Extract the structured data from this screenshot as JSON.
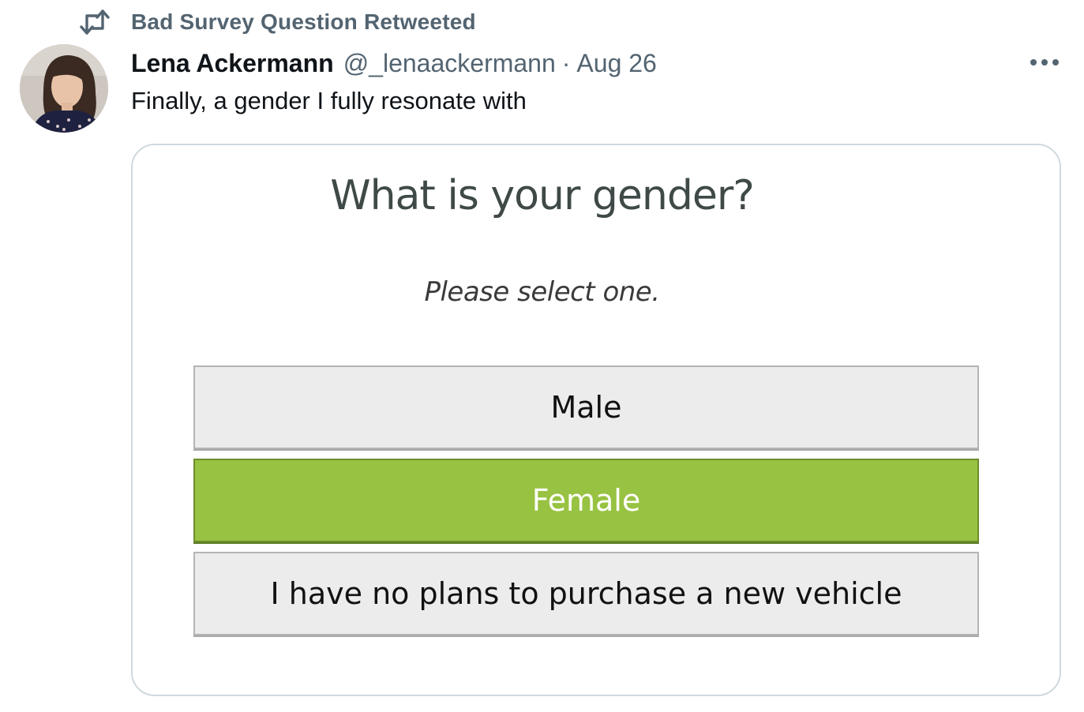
{
  "retweet": {
    "icon": "retweet-icon",
    "label": "Bad Survey Question Retweeted"
  },
  "author": {
    "name": "Lena Ackermann",
    "handle": "@_lenaackermann",
    "separator": "·",
    "date": "Aug 26"
  },
  "tweet": {
    "text": "Finally, a gender I fully resonate with"
  },
  "survey": {
    "question": "What is your gender?",
    "instruction": "Please select one.",
    "options": [
      {
        "label": "Male",
        "selected": false
      },
      {
        "label": "Female",
        "selected": true
      },
      {
        "label": "I have no plans to purchase a new vehicle",
        "selected": false
      }
    ]
  },
  "colors": {
    "secondary_text": "#536471",
    "selected_option": "#98c242",
    "card_border": "#cfd9de"
  }
}
